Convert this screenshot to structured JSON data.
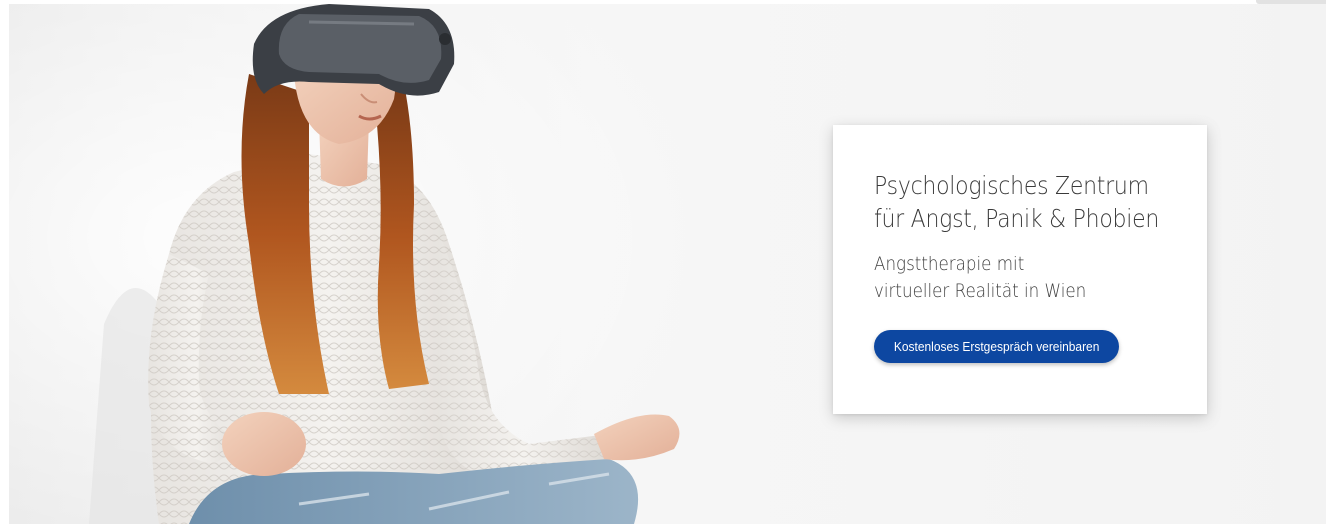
{
  "hero": {
    "image_alt": "Frau mit VR-Brille in Meditationshaltung",
    "card": {
      "title_line1": "Psychologisches Zentrum",
      "title_line2": "für Angst, Panik & Phobien",
      "subtitle_line1": "Angsttherapie mit",
      "subtitle_line2": "virtueller Realität in Wien",
      "cta_label": "Kostenloses Erstgespräch vereinbaren"
    }
  },
  "colors": {
    "accent": "#0d47a1",
    "card_background": "#ffffff",
    "title_text": "#3a3a3a"
  }
}
